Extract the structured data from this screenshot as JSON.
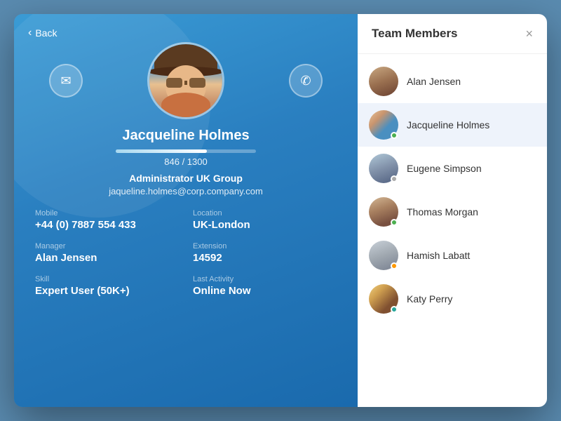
{
  "modal": {
    "left": {
      "back_label": "Back",
      "profile": {
        "name": "Jacqueline Holmes",
        "progress_current": "846",
        "progress_max": "1300",
        "progress_display": "846 / 1300",
        "role": "Administrator UK Group",
        "email": "jaqueline.holmes@corp.company.com"
      },
      "fields": {
        "mobile_label": "Mobile",
        "mobile_value": "+44 (0) 7887 554 433",
        "location_label": "Location",
        "location_value": "UK-London",
        "manager_label": "Manager",
        "manager_value": "Alan Jensen",
        "extension_label": "Extension",
        "extension_value": "14592",
        "skill_label": "Skill",
        "skill_value": "Expert User (50K+)",
        "activity_label": "Last Activity",
        "activity_value": "Online Now"
      },
      "email_btn_icon": "✉",
      "phone_btn_icon": "✆"
    },
    "right": {
      "title": "Team Members",
      "close_icon": "×",
      "members": [
        {
          "id": "alan",
          "name": "Alan Jensen",
          "status": "none",
          "avatar_class": "av-alan"
        },
        {
          "id": "jacqueline",
          "name": "Jacqueline Holmes",
          "status": "green",
          "avatar_class": "av-jacqueline",
          "active": true
        },
        {
          "id": "eugene",
          "name": "Eugene Simpson",
          "status": "gray",
          "avatar_class": "av-eugene"
        },
        {
          "id": "thomas",
          "name": "Thomas Morgan",
          "status": "green",
          "avatar_class": "av-thomas"
        },
        {
          "id": "hamish",
          "name": "Hamish Labatt",
          "status": "orange",
          "avatar_class": "av-hamish"
        },
        {
          "id": "katy",
          "name": "Katy Perry",
          "status": "teal",
          "avatar_class": "av-katy"
        }
      ]
    }
  }
}
